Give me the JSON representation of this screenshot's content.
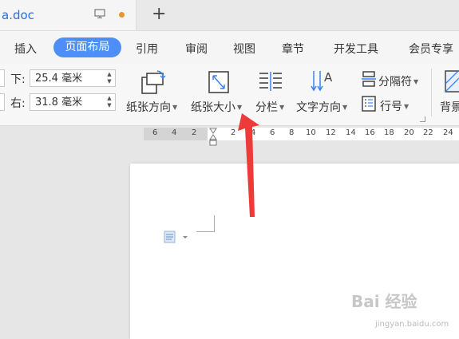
{
  "titlebar": {
    "doc_name": "a.doc",
    "new_tab_label": "+"
  },
  "menu": {
    "items": [
      {
        "label": "插入"
      },
      {
        "label": "页面布局"
      },
      {
        "label": "引用"
      },
      {
        "label": "审阅"
      },
      {
        "label": "视图"
      },
      {
        "label": "章节"
      },
      {
        "label": "开发工具"
      },
      {
        "label": "会员专享"
      }
    ],
    "active_index": 1
  },
  "ribbon": {
    "margin_bottom_label": "下:",
    "margin_bottom_value": "25.4 毫米",
    "margin_right_label": "右:",
    "margin_right_value": "31.8 毫米",
    "orientation_label": "纸张方向",
    "size_label": "纸张大小",
    "columns_label": "分栏",
    "text_direction_label": "文字方向",
    "breaks_label": "分隔符",
    "line_numbers_label": "行号",
    "background_label": "背景"
  },
  "ruler": {
    "ticks": [
      "6",
      "4",
      "2",
      "2",
      "4",
      "6",
      "8",
      "10",
      "12",
      "14",
      "16",
      "18",
      "20",
      "22",
      "24"
    ]
  },
  "watermark": {
    "text": "Bai 经验",
    "sub": "jingyan.baidu.com"
  },
  "colors": {
    "accent": "#4d8ff6",
    "arrow": "#f03a3a",
    "tab_dot": "#f0922a"
  }
}
